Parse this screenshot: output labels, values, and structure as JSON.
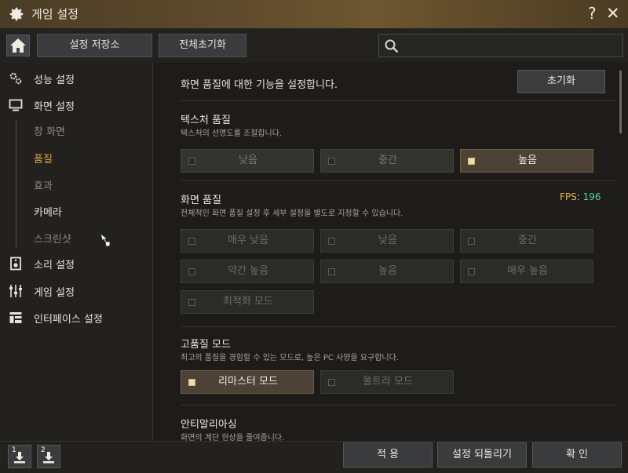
{
  "window": {
    "title": "게임 설정",
    "help_label": "?",
    "close_label": "✕"
  },
  "toolbar": {
    "home_icon": "home-icon",
    "buttons": [
      "설정 저장소",
      "전체초기화"
    ],
    "search": {
      "value": "",
      "placeholder": ""
    }
  },
  "sidebar": {
    "items": [
      {
        "label": "성능 설정",
        "icon": "gears-icon"
      },
      {
        "label": "화면 설정",
        "icon": "monitor-icon"
      },
      {
        "label": "소리 설정",
        "icon": "speaker-icon"
      },
      {
        "label": "게임 설정",
        "icon": "sliders-icon"
      },
      {
        "label": "인터페이스 설정",
        "icon": "interface-icon"
      }
    ],
    "subitems": [
      "창 화면",
      "품질",
      "효과",
      "카메라",
      "스크린샷"
    ],
    "active_subitem": "품질"
  },
  "main": {
    "header": "화면 품질에 대한 기능을 설정합니다.",
    "reset_label": "초기화",
    "texture": {
      "title": "텍스처 품질",
      "desc": "텍스처의 선명도를 조절합니다.",
      "options": [
        "낮음",
        "중간",
        "높음"
      ],
      "selected": "높음"
    },
    "screen_quality": {
      "title": "화면 품질",
      "desc": "전체적인 화면 품질 설정 후 세부 설정을 별도로 지정할 수 있습니다.",
      "fps_label": "FPS:",
      "fps_value": "196",
      "options": [
        "매우 낮음",
        "낮음",
        "중간",
        "약간 높음",
        "높음",
        "매우 높음",
        "최적화 모드"
      ]
    },
    "high_quality": {
      "title": "고품질 모드",
      "desc": "최고의 품질을 경험할 수 있는 모드로, 높은 PC 사양을 요구합니다.",
      "options": [
        "리마스터 모드",
        "울트라 모드"
      ],
      "selected": "리마스터 모드"
    },
    "antialiasing": {
      "title": "안티알리아싱",
      "desc": "화면의 계단 현상을 줄여줍니다."
    }
  },
  "bottom": {
    "slots": [
      "1",
      "2"
    ],
    "buttons": [
      "적 용",
      "설정 되돌리기",
      "확 인"
    ]
  },
  "colors": {
    "accent": "#e0a44a",
    "fps_value": "#4fd6a0",
    "fps_label": "#e0b84f"
  }
}
